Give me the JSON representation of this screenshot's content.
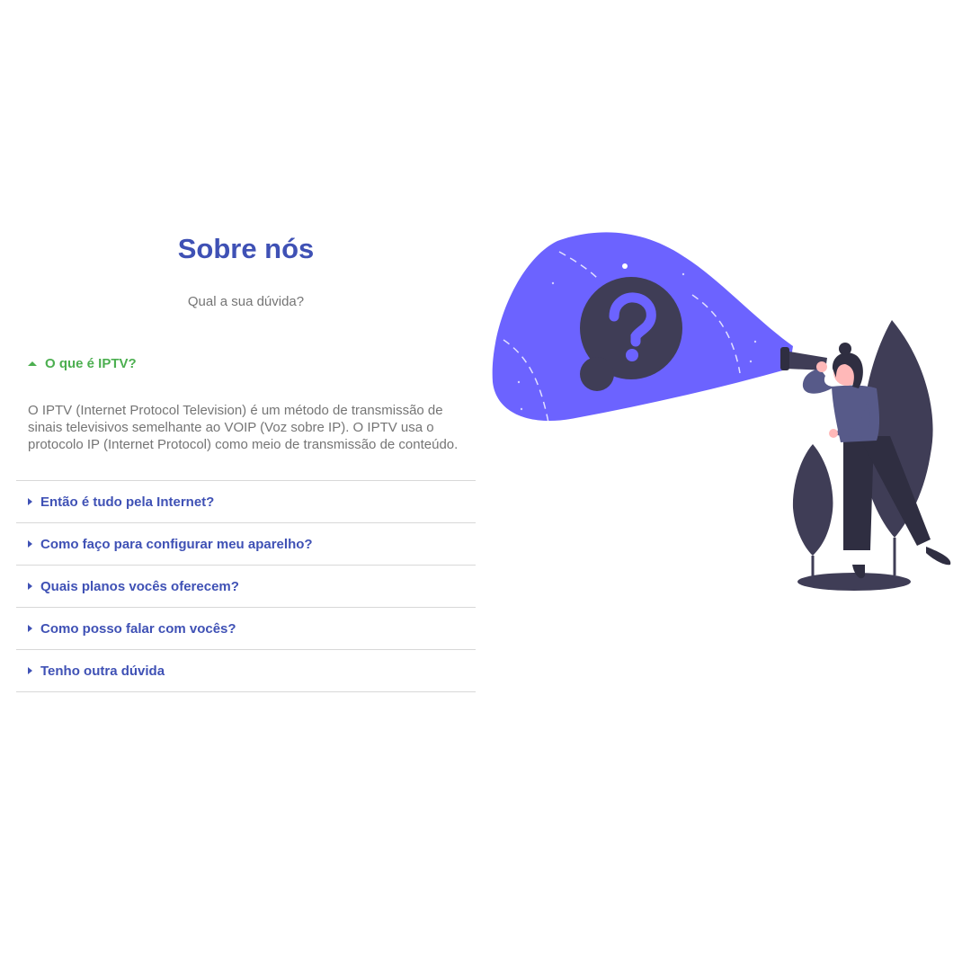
{
  "header": {
    "title": "Sobre nós",
    "subtitle": "Qual a sua dúvida?"
  },
  "faq": {
    "open_item": {
      "question": "O que é IPTV?",
      "answer": "O IPTV (Internet Protocol Television) é um método de transmissão de sinais televisivos semelhante ao VOIP (Voz sobre IP). O IPTV usa o protocolo IP (Internet Protocol) como meio de transmissão de conteúdo."
    },
    "items": [
      {
        "question": "Então é tudo pela Internet?"
      },
      {
        "question": "Como faço para configurar meu aparelho?"
      },
      {
        "question": "Quais planos vocês oferecem?"
      },
      {
        "question": "Como posso falar com vocês?"
      },
      {
        "question": "Tenho outra dúvida"
      }
    ]
  },
  "colors": {
    "primary": "#3f51b5",
    "active": "#4caf50",
    "muted_text": "#757575",
    "illustration_accent": "#6c63ff",
    "illustration_dark": "#3f3d56"
  },
  "icons": {
    "open_caret": "caret-up-icon",
    "closed_caret": "caret-right-icon",
    "illustration": "question-mark-icon"
  }
}
